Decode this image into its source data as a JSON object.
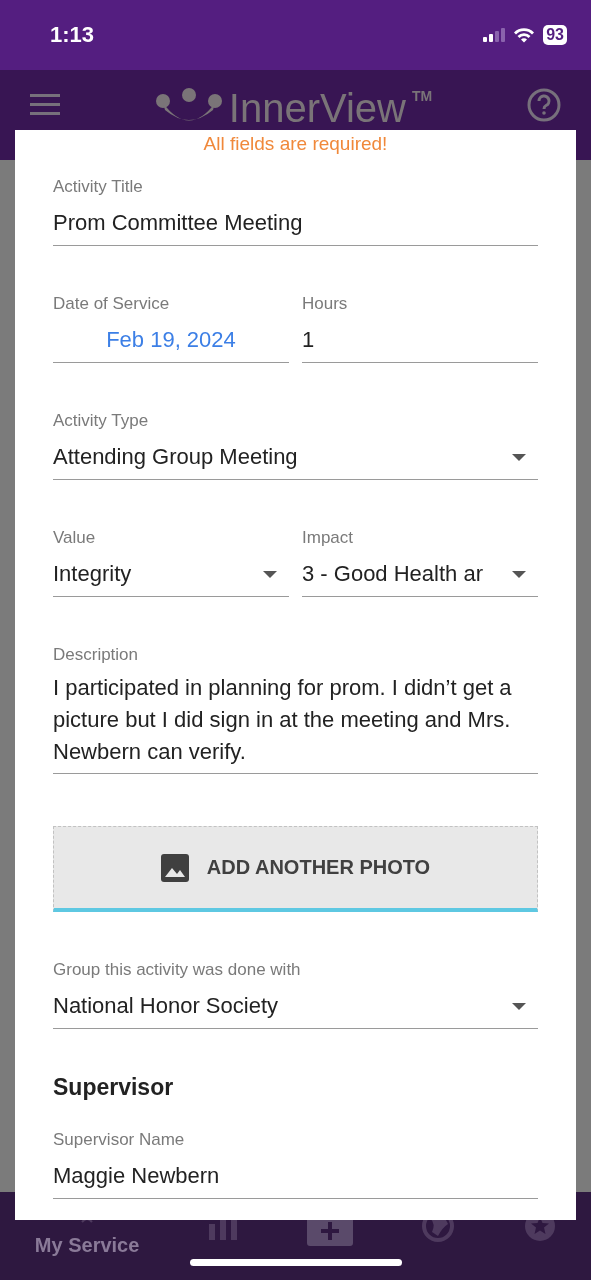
{
  "status_bar": {
    "time": "1:13",
    "battery": "93"
  },
  "app_bar": {
    "title": "InnerView",
    "trademark": "TM"
  },
  "form": {
    "notice": "All fields are required!",
    "rows": [
      [
        {
          "kind": "text",
          "label": "Activity Title",
          "value": "Prom Committee Meeting"
        }
      ],
      [
        {
          "kind": "date",
          "label": "Date of Service",
          "value": "Feb 19, 2024"
        },
        {
          "kind": "text",
          "label": "Hours",
          "value": "1"
        }
      ],
      [
        {
          "kind": "dropdown",
          "label": "Activity Type",
          "value": "Attending Group Meeting"
        }
      ],
      [
        {
          "kind": "dropdown",
          "label": "Value",
          "value": "Integrity"
        },
        {
          "kind": "dropdown",
          "label": "Impact",
          "value": "3 - Good Health ar"
        }
      ],
      [
        {
          "kind": "textarea",
          "label": "Description",
          "value": "I participated in planning for prom. I didn’t get a picture but I did sign in at the meeting and Mrs. Newbern can verify."
        }
      ],
      [
        {
          "kind": "upload",
          "label": "ADD ANOTHER PHOTO"
        }
      ],
      [
        {
          "kind": "dropdown",
          "label": "Group this activity was done with",
          "value": "National Honor Society"
        }
      ],
      [
        {
          "kind": "heading",
          "label": "Supervisor"
        }
      ],
      [
        {
          "kind": "text",
          "label": "Supervisor Name",
          "value": "Maggie Newbern"
        }
      ]
    ]
  },
  "bottom_nav": {
    "label": "My Service"
  }
}
